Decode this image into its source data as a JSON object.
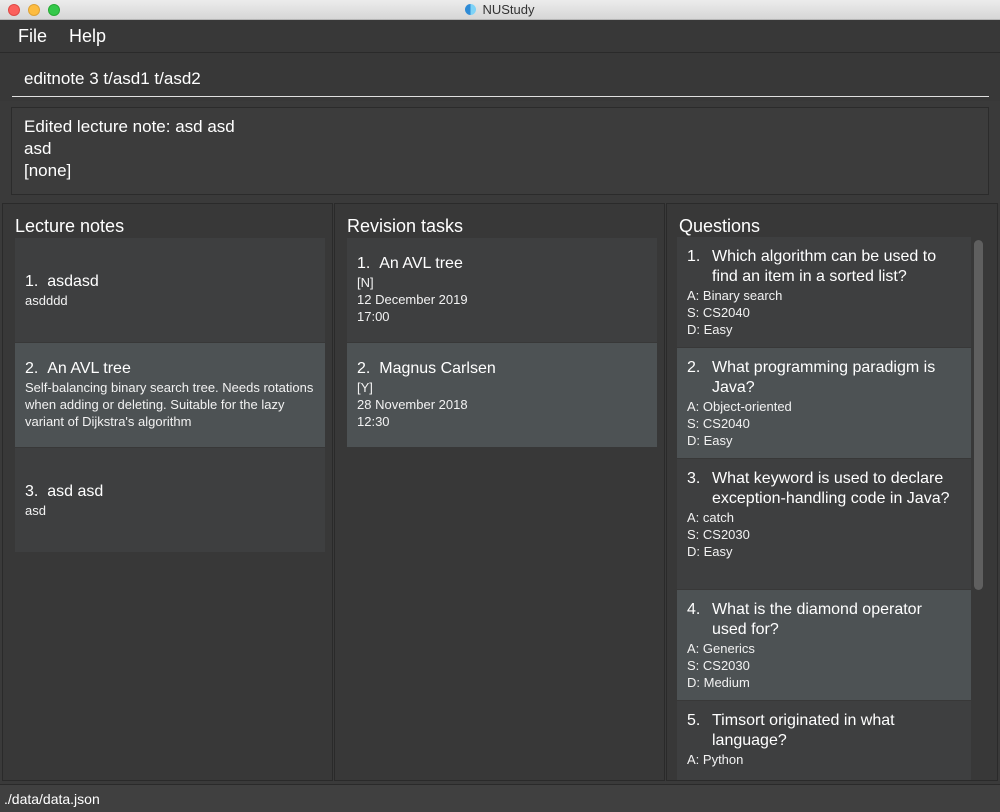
{
  "window": {
    "title": "NUStudy"
  },
  "menu": {
    "file": "File",
    "help": "Help"
  },
  "command": {
    "value": "editnote 3 t/asd1 t/asd2"
  },
  "result": {
    "lines": [
      "Edited lecture note: asd asd",
      "asd",
      "[none]"
    ]
  },
  "lecture_notes": {
    "title": "Lecture notes",
    "items": [
      {
        "index": "1.",
        "title": "asdasd",
        "body": "asdddd"
      },
      {
        "index": "2.",
        "title": "An AVL tree",
        "body": "Self-balancing binary search tree. Needs rotations when adding or deleting. Suitable for the lazy variant of Dijkstra's algorithm"
      },
      {
        "index": "3.",
        "title": "asd asd",
        "body": "asd"
      }
    ]
  },
  "revision_tasks": {
    "title": "Revision tasks",
    "items": [
      {
        "index": "1.",
        "title": "An AVL tree",
        "status": "[N]",
        "date": "12 December 2019",
        "time": "17:00"
      },
      {
        "index": "2.",
        "title": "Magnus Carlsen",
        "status": "[Y]",
        "date": "28 November 2018",
        "time": "12:30"
      }
    ]
  },
  "questions": {
    "title": "Questions",
    "items": [
      {
        "index": "1.",
        "question": "Which algorithm can be used to find an item in a sorted list?",
        "answer": "A: Binary search",
        "subject": "S: CS2040",
        "difficulty": "D: Easy"
      },
      {
        "index": "2.",
        "question": "What programming paradigm is Java?",
        "answer": "A: Object-oriented",
        "subject": "S: CS2040",
        "difficulty": "D: Easy"
      },
      {
        "index": "3.",
        "question": "What keyword is used to declare exception-handling code in Java?",
        "answer": "A: catch",
        "subject": "S: CS2030",
        "difficulty": "D: Easy"
      },
      {
        "index": "4.",
        "question": "What is the diamond operator used for?",
        "answer": "A: Generics",
        "subject": "S: CS2030",
        "difficulty": "D: Medium"
      },
      {
        "index": "5.",
        "question": "Timsort originated in what language?",
        "answer": "A: Python",
        "subject": "",
        "difficulty": ""
      }
    ]
  },
  "status_bar": {
    "path": "./data/data.json"
  },
  "colors": {
    "background": "#3a3a3a",
    "card_odd": "#3e3f40",
    "card_selected": "#4d5254",
    "close": "#fc605c",
    "minimize": "#fdbc40",
    "maximize": "#34c84a"
  }
}
